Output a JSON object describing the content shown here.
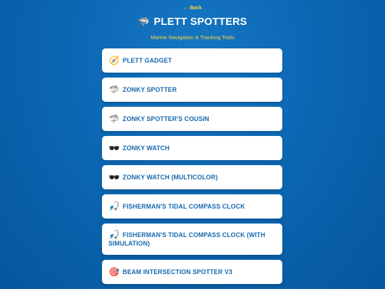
{
  "nav": {
    "back_label": "← Back"
  },
  "header": {
    "icon": "shark-icon",
    "title": "PLETT SPOTTERS",
    "subtitle": "Marine Navigation & Tracking Tools"
  },
  "tools": [
    {
      "label": "PLETT GADGET",
      "icon": "compass-icon"
    },
    {
      "label": "ZONKY SPOTTER",
      "icon": "shark-icon"
    },
    {
      "label": "ZONKY SPOTTER'S COUSIN",
      "icon": "shark-icon"
    },
    {
      "label": "ZONKY WATCH",
      "icon": "sunglasses-icon"
    },
    {
      "label": "ZONKY WATCH (MULTICOLOR)",
      "icon": "sunglasses-icon"
    },
    {
      "label": "FISHERMAN'S TIDAL COMPASS CLOCK",
      "icon": "fishing-pole-icon"
    },
    {
      "label": "FISHERMAN'S TIDAL COMPASS CLOCK (WITH SIMULATION)",
      "icon": "fishing-pole-icon"
    },
    {
      "label": "BEAM INTERSECTION SPOTTER V3",
      "icon": "target-icon"
    }
  ],
  "colors": {
    "background": "#0b67b3",
    "accent": "#ffd23f",
    "card_text": "#1769ae"
  }
}
